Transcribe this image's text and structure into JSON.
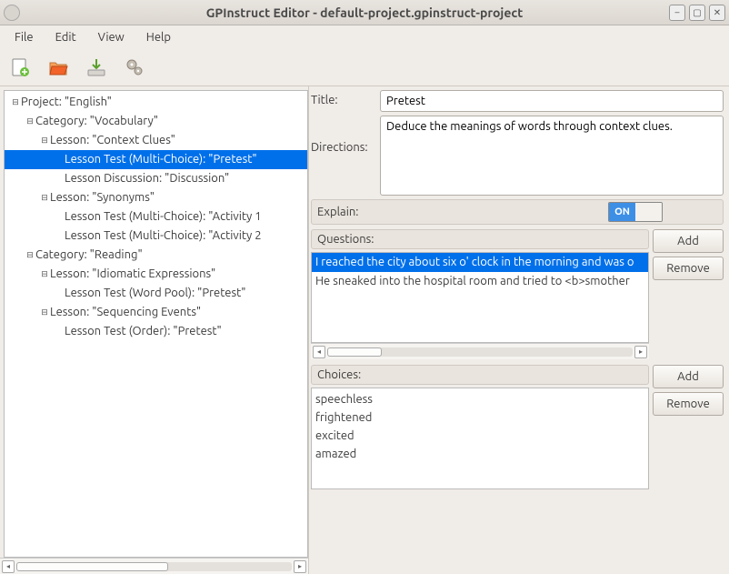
{
  "window": {
    "title": "GPInstruct Editor - default-project.gpinstruct-project"
  },
  "menubar": [
    "File",
    "Edit",
    "View",
    "Help"
  ],
  "toolbar": [
    "new-file-icon",
    "open-file-icon",
    "save-icon",
    "settings-icon"
  ],
  "tree": [
    {
      "indent": 0,
      "twisty": "⊟",
      "label": "Project: \"English\""
    },
    {
      "indent": 1,
      "twisty": "⊟",
      "label": "Category: \"Vocabulary\""
    },
    {
      "indent": 2,
      "twisty": "⊟",
      "label": "Lesson: \"Context Clues\""
    },
    {
      "indent": 3,
      "twisty": "",
      "label": "Lesson Test (Multi-Choice): \"Pretest\"",
      "selected": true
    },
    {
      "indent": 3,
      "twisty": "",
      "label": "Lesson Discussion: \"Discussion\""
    },
    {
      "indent": 2,
      "twisty": "⊟",
      "label": "Lesson: \"Synonyms\""
    },
    {
      "indent": 3,
      "twisty": "",
      "label": "Lesson Test (Multi-Choice): \"Activity 1"
    },
    {
      "indent": 3,
      "twisty": "",
      "label": "Lesson Test (Multi-Choice): \"Activity 2"
    },
    {
      "indent": 1,
      "twisty": "⊟",
      "label": "Category: \"Reading\""
    },
    {
      "indent": 2,
      "twisty": "⊟",
      "label": "Lesson: \"Idiomatic Expressions\""
    },
    {
      "indent": 3,
      "twisty": "",
      "label": "Lesson Test (Word Pool): \"Pretest\""
    },
    {
      "indent": 2,
      "twisty": "⊟",
      "label": "Lesson: \"Sequencing Events\""
    },
    {
      "indent": 3,
      "twisty": "",
      "label": "Lesson Test (Order): \"Pretest\""
    }
  ],
  "form": {
    "title_label": "Title:",
    "title_value": "Pretest",
    "directions_label": "Directions:",
    "directions_value": "Deduce the meanings of words through context clues.",
    "explain_label": "Explain:",
    "explain_value": "ON",
    "questions_label": "Questions:",
    "choices_label": "Choices:"
  },
  "questions": [
    {
      "text": "I reached the city about six o' clock in the morning and was o",
      "selected": true
    },
    {
      "text": "He sneaked into the hospital room and tried to <b>smother",
      "selected": false
    }
  ],
  "choices": [
    "speechless",
    "frightened",
    "excited",
    "amazed"
  ],
  "buttons": {
    "add": "Add",
    "remove": "Remove"
  }
}
